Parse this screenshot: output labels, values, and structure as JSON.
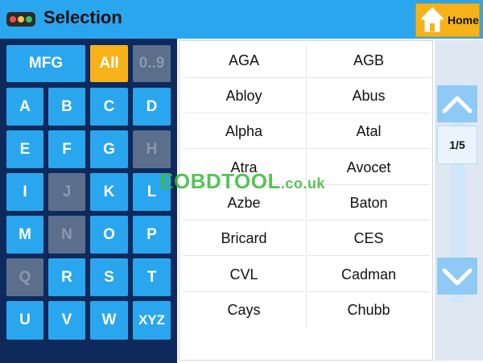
{
  "header": {
    "title": "Selection",
    "home_label": "Home",
    "dot_colors": [
      "#f24b4b",
      "#f5c542",
      "#3fbf6a"
    ]
  },
  "keypad": {
    "rows": [
      [
        {
          "label": "MFG",
          "state": "normal"
        },
        {
          "label": "All",
          "state": "active"
        },
        {
          "label": "0..9",
          "state": "disabled"
        }
      ],
      [
        {
          "label": "A",
          "state": "normal"
        },
        {
          "label": "B",
          "state": "normal"
        },
        {
          "label": "C",
          "state": "normal"
        },
        {
          "label": "D",
          "state": "normal"
        }
      ],
      [
        {
          "label": "E",
          "state": "normal"
        },
        {
          "label": "F",
          "state": "normal"
        },
        {
          "label": "G",
          "state": "normal"
        },
        {
          "label": "H",
          "state": "disabled"
        }
      ],
      [
        {
          "label": "I",
          "state": "normal"
        },
        {
          "label": "J",
          "state": "disabled"
        },
        {
          "label": "K",
          "state": "normal"
        },
        {
          "label": "L",
          "state": "normal"
        }
      ],
      [
        {
          "label": "M",
          "state": "normal"
        },
        {
          "label": "N",
          "state": "disabled"
        },
        {
          "label": "O",
          "state": "normal"
        },
        {
          "label": "P",
          "state": "normal"
        }
      ],
      [
        {
          "label": "Q",
          "state": "disabled"
        },
        {
          "label": "R",
          "state": "normal"
        },
        {
          "label": "S",
          "state": "normal"
        },
        {
          "label": "T",
          "state": "normal"
        }
      ],
      [
        {
          "label": "U",
          "state": "normal"
        },
        {
          "label": "V",
          "state": "normal"
        },
        {
          "label": "W",
          "state": "normal"
        },
        {
          "label": "XYZ",
          "state": "normal"
        }
      ]
    ]
  },
  "list": {
    "items": [
      "AGA",
      "AGB",
      "Abloy",
      "Abus",
      "Alpha",
      "Atal",
      "Atra",
      "Avocet",
      "Azbe",
      "Baton",
      "Bricard",
      "CES",
      "CVL",
      "Cadman",
      "Cays",
      "Chubb"
    ]
  },
  "scroll": {
    "page": "1/5"
  },
  "watermark": {
    "text": "EOBDTOOL",
    "tld": ".co.uk"
  },
  "colors": {
    "accent": "#2aa6ee",
    "active": "#f7b21a",
    "panel": "#0e2a5c",
    "disabled": "#5b6f8d"
  }
}
